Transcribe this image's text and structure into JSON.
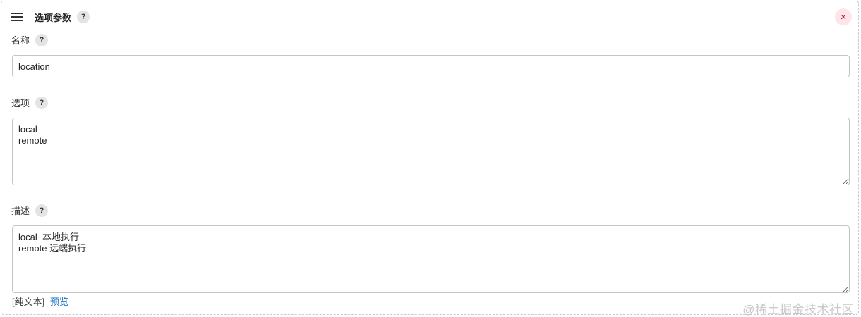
{
  "header": {
    "title": "选项参数",
    "help_label": "?",
    "close_label": "×"
  },
  "fields": {
    "name": {
      "label": "名称",
      "help_label": "?",
      "value": "location"
    },
    "options": {
      "label": "选项",
      "help_label": "?",
      "value": "local\nremote"
    },
    "description": {
      "label": "描述",
      "help_label": "?",
      "value": "local  本地执行\nremote 远端执行"
    }
  },
  "format": {
    "plain_text_label": "[纯文本]",
    "preview_label": "预览"
  },
  "watermark": "@稀土掘金技术社区",
  "colors": {
    "accent_link": "#1a73c8",
    "close_fg": "#d11b3b",
    "close_bg": "#fde6ea"
  },
  "icons": {
    "drag": "hamburger-icon",
    "help": "question-mark-icon",
    "close": "close-icon"
  }
}
